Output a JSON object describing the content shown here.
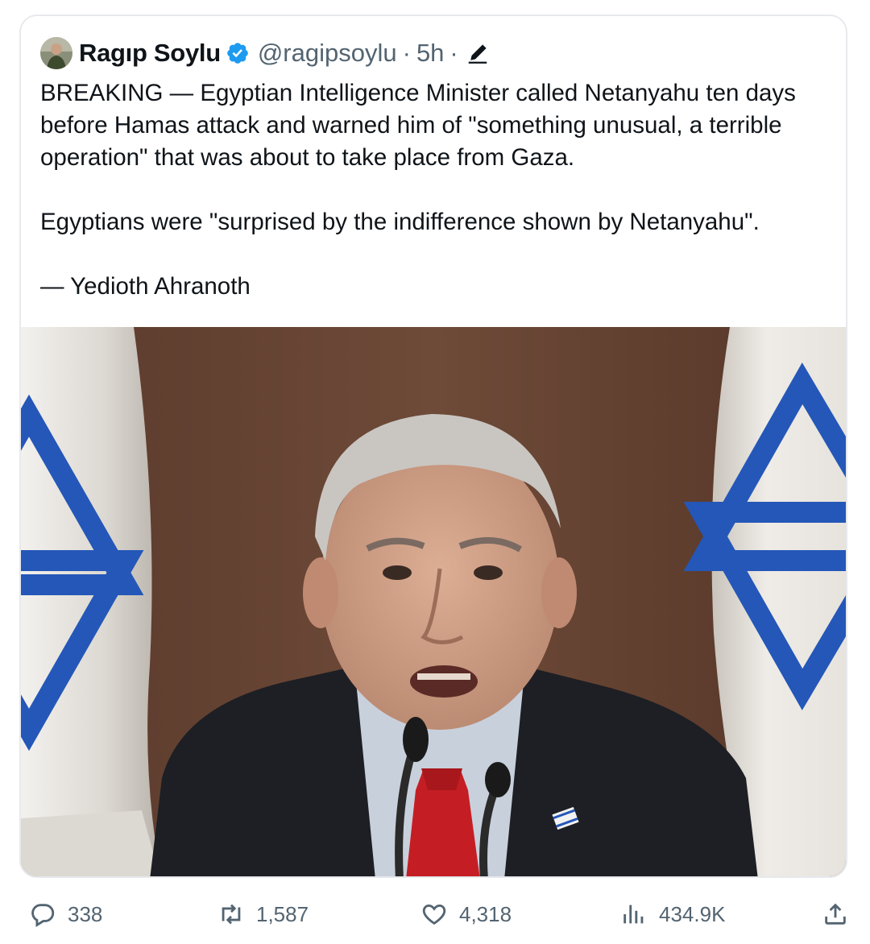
{
  "tweet": {
    "author": {
      "display_name": "Ragıp Soylu",
      "handle": "@ragipsoylu",
      "separator": "·",
      "time": "5h",
      "verified_icon": "verified-badge-icon",
      "edit_icon": "edited-pencil-icon"
    },
    "paragraphs": [
      "BREAKING — Egyptian Intelligence Minister called Netanyahu ten days before Hamas attack and warned him of \"something unusual, a terrible operation\" that was about to take place from Gaza.",
      "Egyptians were \"surprised by the indifference shown by Netanyahu\".",
      "— Yedioth Ahranoth"
    ],
    "media": {
      "type": "photo"
    },
    "metrics": {
      "replies": "338",
      "retweets": "1,587",
      "likes": "4,318",
      "views": "434.9K"
    }
  },
  "colors": {
    "text": "#0f1419",
    "secondary": "#536471",
    "verified": "#1d9bf0",
    "border": "#e7e9ec"
  }
}
